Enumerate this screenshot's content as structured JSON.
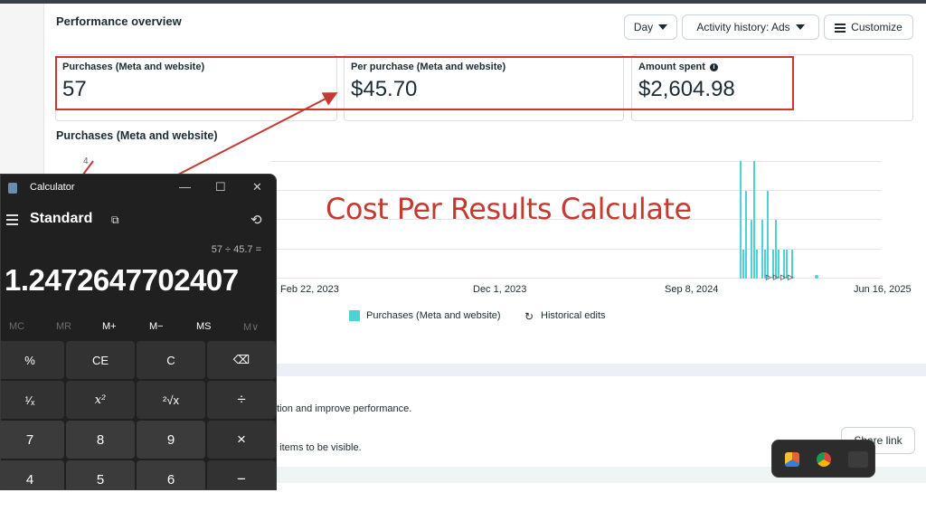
{
  "performance": {
    "title": "Performance overview",
    "day_button": "Day",
    "activity_button": "Activity history: Ads",
    "customize_button": "Customize",
    "metrics": [
      {
        "label": "Purchases (Meta and website)",
        "value": "57"
      },
      {
        "label": "Per purchase (Meta and website)",
        "value": "$45.70"
      },
      {
        "label": "Amount spent",
        "value": "$2,604.98"
      }
    ],
    "info_icon_glyph": "i"
  },
  "chart": {
    "title": "Purchases (Meta and website)",
    "y_tick": "4",
    "x_labels": [
      "Feb 22, 2023",
      "Dec 1, 2023",
      "Sep 8, 2024",
      "Jun 16, 2025"
    ],
    "legend": {
      "series": "Purchases (Meta and website)",
      "edits": "Historical edits"
    },
    "edit_marks": "ᐓᐓᐓᐓ"
  },
  "chart_data": {
    "type": "bar",
    "title": "Purchases (Meta and website)",
    "x_ticks": [
      "Feb 22, 2023",
      "Dec 1, 2023",
      "Sep 8, 2024",
      "Jun 16, 2025"
    ],
    "ylim": [
      0,
      4
    ],
    "series": [
      {
        "name": "Purchases (Meta and website)",
        "values": [
          4,
          1,
          3,
          0,
          2,
          4,
          1,
          0,
          2,
          1,
          3,
          0,
          1,
          2,
          1,
          0,
          1,
          1,
          0,
          1
        ]
      }
    ],
    "color": "#4dd2d6",
    "grid": true
  },
  "annotation": {
    "text": "Cost Per Results Calculate",
    "color": "#c43a32"
  },
  "lower": {
    "line1": "ption and improve performance.",
    "line2": "e items to be visible.",
    "share_button": "Share link"
  },
  "calculator": {
    "app_name": "Calculator",
    "mode": "Standard",
    "expression": "57 ÷ 45.7 =",
    "display": "1.2472647702407",
    "memory_keys": [
      "MC",
      "MR",
      "M+",
      "M−",
      "MS",
      "M∨"
    ],
    "rows": [
      [
        "%",
        "CE",
        "C",
        "⌫"
      ],
      [
        "¹⁄ₓ",
        "x²",
        "²√x",
        "÷"
      ],
      [
        "7",
        "8",
        "9",
        "×"
      ],
      [
        "4",
        "5",
        "6",
        "−"
      ]
    ],
    "window_buttons": [
      "—",
      "☐",
      "✕"
    ],
    "menu_icon": "hamburger-icon",
    "history_icon_glyph": "⟲",
    "keep_on_top_glyph": "⧉"
  },
  "taskbar": {
    "icons": [
      "calculator-app-icon",
      "chrome-icon",
      "feather-icon"
    ]
  },
  "colors": {
    "accent": "#4dd2d6",
    "annotation_red": "#d0342c"
  }
}
